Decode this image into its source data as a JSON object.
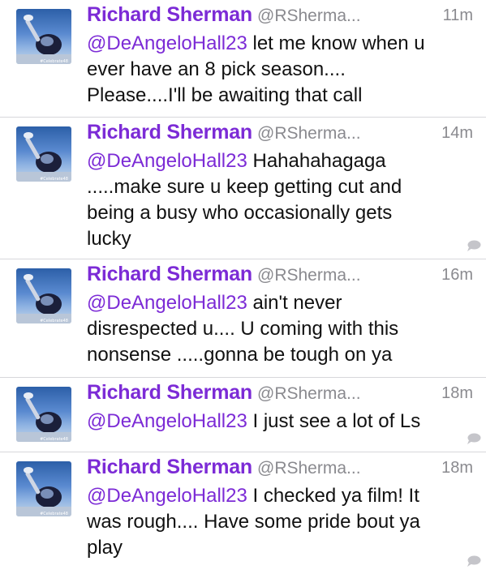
{
  "tweets": [
    {
      "name": "Richard Sherman",
      "handle": "@RSherma...",
      "time": "11m",
      "mention": "@DeAngeloHall23",
      "text_line1": " let me know when u",
      "text_rest": [
        "ever have an 8 pick season....",
        "Please....I'll be awaiting that call"
      ],
      "has_reply_icon": false
    },
    {
      "name": "Richard Sherman",
      "handle": "@RSherma...",
      "time": "14m",
      "mention": "@DeAngeloHall23",
      "text_line1": " Hahahahagaga",
      "text_rest": [
        ".....make sure u keep getting cut and",
        "being a busy who occasionally gets",
        "lucky"
      ],
      "has_reply_icon": true
    },
    {
      "name": "Richard Sherman",
      "handle": "@RSherma...",
      "time": "16m",
      "mention": "@DeAngeloHall23",
      "text_line1": " ain't never",
      "text_rest": [
        "disrespected u.... U coming with this",
        "nonsense .....gonna be tough on ya"
      ],
      "has_reply_icon": false
    },
    {
      "name": "Richard Sherman",
      "handle": "@RSherma...",
      "time": "18m",
      "mention": "@DeAngeloHall23",
      "text_line1": " I just see a lot of Ls",
      "text_rest": [],
      "has_reply_icon": true
    },
    {
      "name": "Richard Sherman",
      "handle": "@RSherma...",
      "time": "18m",
      "mention": "@DeAngeloHall23",
      "text_line1": " I checked ya film! It",
      "text_rest": [
        "was rough.... Have some pride bout ya",
        "play"
      ],
      "has_reply_icon": true
    }
  ],
  "avatar": {
    "icon": "avatar-photo",
    "caption": "#Celebrate48"
  },
  "colors": {
    "name": "#7c2bd6",
    "meta": "#8a8a8f",
    "text": "#111111",
    "divider": "#d7d7db"
  }
}
